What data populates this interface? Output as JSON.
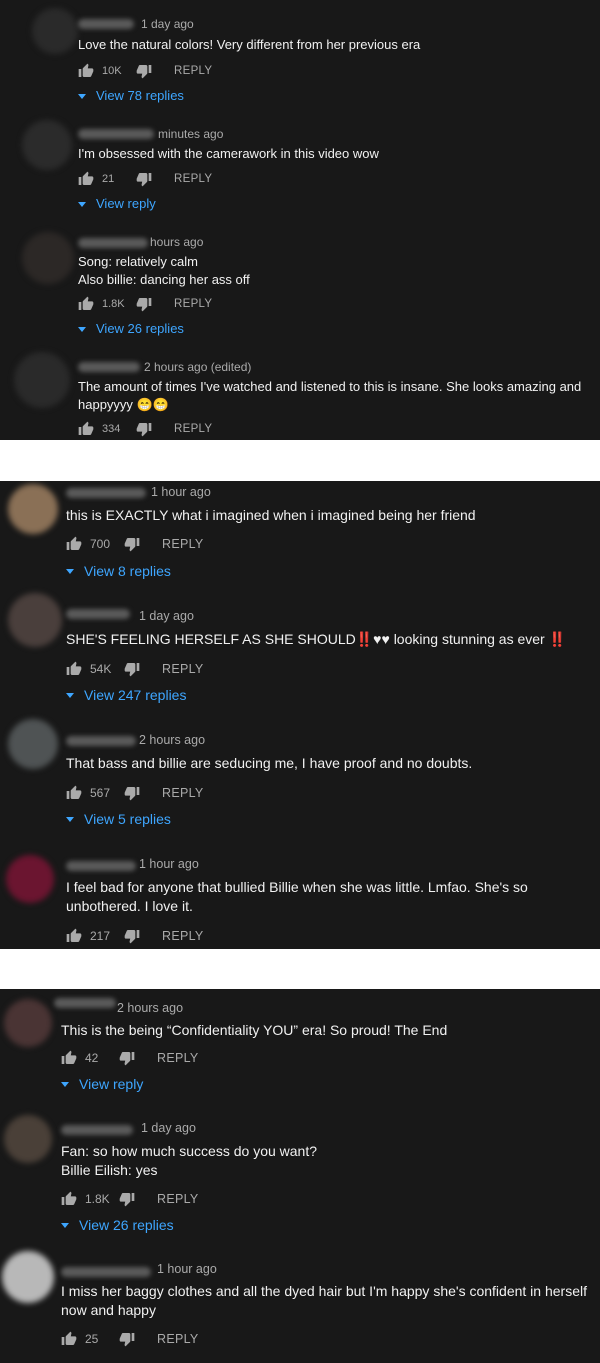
{
  "reply_label": "REPLY",
  "panels": [
    {
      "comments": [
        {
          "time": "1 day ago",
          "text": [
            "Love the natural colors! Very different from her previous era"
          ],
          "likes": "10K",
          "replies": "View 78 replies"
        },
        {
          "time": "minutes ago",
          "text": [
            "I'm obsessed with the camerawork in this video wow"
          ],
          "likes": "21",
          "replies": "View reply"
        },
        {
          "time": "hours ago",
          "text": [
            "Song: relatively calm",
            "Also billie: dancing her ass off"
          ],
          "likes": "1.8K",
          "replies": "View 26 replies"
        },
        {
          "time": "2 hours ago (edited)",
          "text": [
            "The amount of times I've watched and listened to this is insane. She looks amazing and",
            "happyyyy 😁😁"
          ],
          "likes": "334",
          "replies": ""
        }
      ]
    },
    {
      "comments": [
        {
          "time": "1 hour ago",
          "text": [
            "this is EXACTLY what i imagined when i imagined being her friend"
          ],
          "likes": "700",
          "replies": "View 8 replies"
        },
        {
          "time": "1 day ago",
          "text": [
            "SHE'S FEELING HERSELF AS SHE SHOULD‼️♥♥ looking stunning as ever ‼️"
          ],
          "likes": "54K",
          "replies": "View 247 replies"
        },
        {
          "time": "2 hours ago",
          "text": [
            "That bass and billie are seducing me, I have proof and no doubts."
          ],
          "likes": "567",
          "replies": "View 5 replies"
        },
        {
          "time": "1 hour ago",
          "text": [
            "I feel bad for anyone that bullied Billie when she was little. Lmfao. She's so",
            "unbothered. I love it."
          ],
          "likes": "217",
          "replies": ""
        }
      ]
    },
    {
      "comments": [
        {
          "time": "2 hours ago",
          "text": [
            "This is the being “Confidentiality YOU” era! So proud! The End"
          ],
          "likes": "42",
          "replies": "View reply"
        },
        {
          "time": "1 day ago",
          "text": [
            "Fan: so how much success do you want?",
            "Billie Eilish: yes"
          ],
          "likes": "1.8K",
          "replies": "View 26 replies"
        },
        {
          "time": "1 hour ago",
          "text": [
            "I miss her baggy clothes and all the dyed hair but I'm happy she's confident in herself",
            "now and happy"
          ],
          "likes": "25",
          "replies": ""
        }
      ]
    }
  ]
}
